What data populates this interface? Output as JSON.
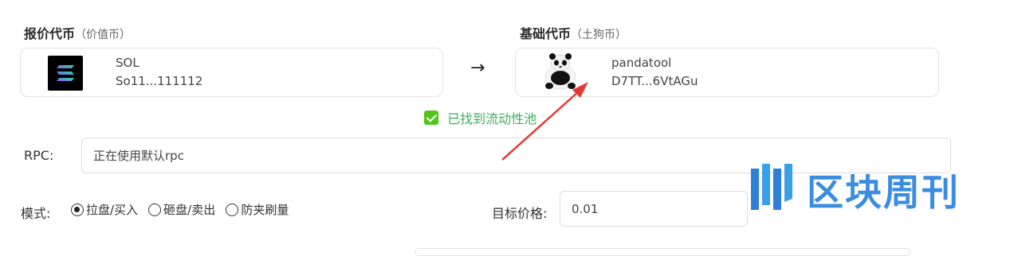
{
  "quote": {
    "title": "报价代币",
    "subtitle": "（价值币）",
    "token_name": "SOL",
    "token_address": "So11...111112"
  },
  "base": {
    "title": "基础代币",
    "subtitle": "（土狗币）",
    "token_name": "pandatool",
    "token_address": "D7TT...6VtAGu"
  },
  "arrow": "→",
  "pool_status": "已找到流动性池",
  "rpc": {
    "label": "RPC:",
    "value": "正在使用默认rpc"
  },
  "mode": {
    "label": "模式:",
    "options": [
      {
        "label": "拉盘/买入",
        "selected": true
      },
      {
        "label": "砸盘/卖出",
        "selected": false
      },
      {
        "label": "防夹刷量",
        "selected": false
      }
    ]
  },
  "target_price": {
    "label": "目标价格:",
    "value": "0.01"
  },
  "watermark": {
    "text": "区块周刊"
  },
  "colors": {
    "success": "#3fae59",
    "annotation_arrow": "#e53935",
    "watermark": "#3b8de0"
  },
  "icons": {
    "quote_token": "solana-logo-icon",
    "base_token": "panda-logo-icon",
    "check": "check-icon"
  }
}
